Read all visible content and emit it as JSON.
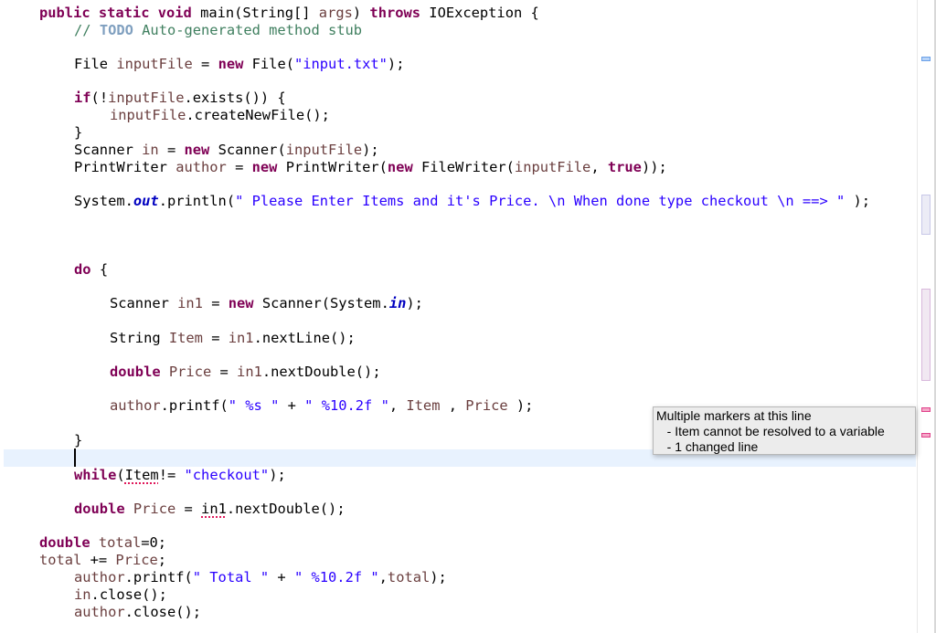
{
  "editor": {
    "lines": {
      "l1": {
        "kw1": "public static void",
        "a": " main(String[] ",
        "v1": "args",
        "b": ") ",
        "kw2": "throws",
        "c": " IOException {"
      },
      "l2": {
        "cmt1": "// ",
        "todo": "TODO",
        "cmt2": " Auto-generated method stub"
      },
      "l3": {
        "a": "File ",
        "v1": "inputFile",
        "b": " = ",
        "kw1": "new",
        "c": " File(",
        "s1": "\"input.txt\"",
        "d": ");"
      },
      "l4": {
        "kw1": "if",
        "a": "(!",
        "v1": "inputFile",
        "b": ".exists()) {"
      },
      "l5": {
        "v1": "inputFile",
        "a": ".createNewFile();"
      },
      "l6": {
        "a": "}"
      },
      "l7": {
        "a": "Scanner ",
        "v1": "in",
        "b": " = ",
        "kw1": "new",
        "c": " Scanner(",
        "v2": "inputFile",
        "d": ");"
      },
      "l8": {
        "a": "PrintWriter ",
        "v1": "author",
        "b": " = ",
        "kw1": "new",
        "c": " PrintWriter(",
        "kw2": "new",
        "d": " FileWriter(",
        "v2": "inputFile",
        "e": ", ",
        "kw3": "true",
        "f": "));"
      },
      "l9": {
        "a": "System.",
        "st": "out",
        "b": ".println(",
        "s1": "\" Please Enter Items and it's Price. \\n When done type checkout \\n ==> \"",
        "c": " );"
      },
      "l10": {
        "kw1": "do",
        "a": " {"
      },
      "l11": {
        "a": "Scanner ",
        "v1": "in1",
        "b": " = ",
        "kw1": "new",
        "c": " Scanner(System.",
        "st": "in",
        "d": ");"
      },
      "l12": {
        "a": "String ",
        "v1": "Item",
        "b": " = ",
        "v2": "in1",
        "c": ".nextLine();"
      },
      "l13": {
        "kw1": "double",
        "a": " ",
        "v1": "Price",
        "b": " = ",
        "v2": "in1",
        "c": ".nextDouble();"
      },
      "l14": {
        "v1": "author",
        "a": ".printf(",
        "s1": "\" %s \"",
        "b": " + ",
        "s2": "\" %10.2f \"",
        "c": ", ",
        "v2": "Item",
        "d": " , ",
        "v3": "Price",
        "e": " );"
      },
      "l15": {
        "a": "}"
      },
      "l16": {
        "kw1": "while",
        "a": "(",
        "e1": "Item",
        "b": "!= ",
        "s1": "\"checkout\"",
        "c": ");"
      },
      "l17": {
        "kw1": "double",
        "a": " ",
        "v1": "Price",
        "b": " = ",
        "e1": "in1",
        "c": ".nextDouble();"
      },
      "l18": {
        "kw1": "double",
        "a": " ",
        "v1": "total",
        "b": "=0;"
      },
      "l19": {
        "v1": "total",
        "a": " += ",
        "v2": "Price",
        "b": ";"
      },
      "l20": {
        "v1": "author",
        "a": ".printf(",
        "s1": "\" Total \"",
        "b": " + ",
        "s2": "\" %10.2f \"",
        "c": ",",
        "v2": "total",
        "d": ");"
      },
      "l21": {
        "v1": "in",
        "a": ".close();"
      },
      "l22": {
        "v1": "author",
        "a": ".close();"
      }
    }
  },
  "tooltip": {
    "title": "Multiple markers at this line",
    "items": [
      "   - Item cannot be resolved to a variable",
      "   - 1 changed line"
    ]
  },
  "colors": {
    "keyword": "#7f0055",
    "string": "#2a00ff",
    "comment": "#3f7f5f",
    "variable": "#6a3e3e",
    "error_underline": "#e0195b",
    "current_line": "#e8f2fe"
  }
}
